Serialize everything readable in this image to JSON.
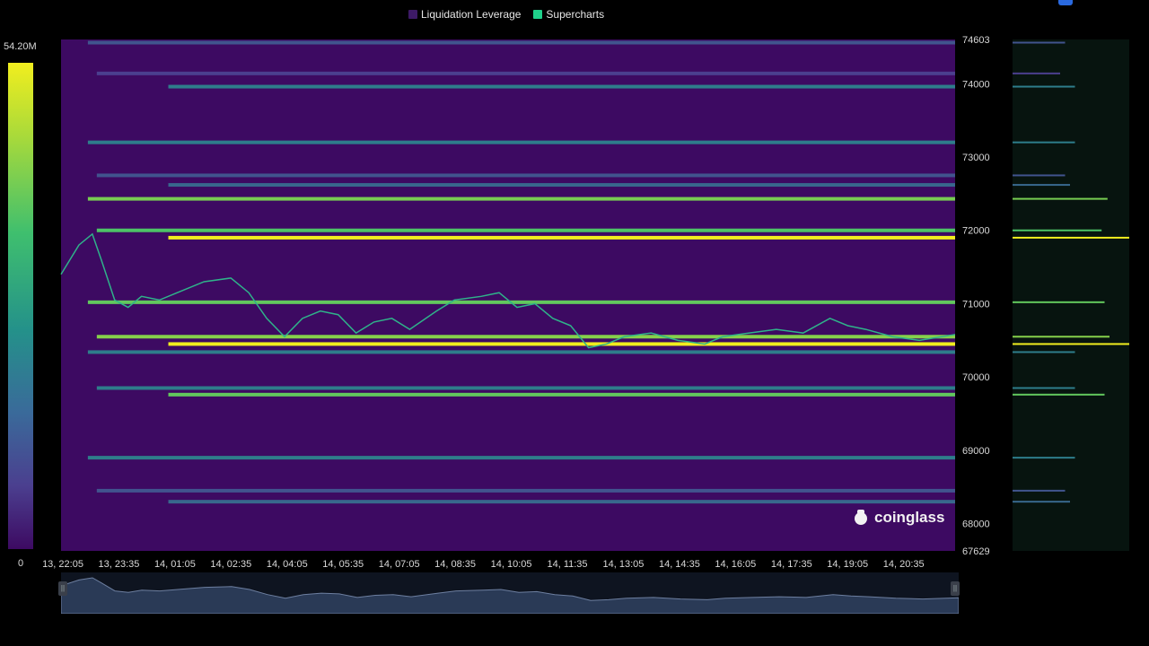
{
  "legend": [
    {
      "label": "Liquidation Leverage",
      "color": "#3d1a66"
    },
    {
      "label": "Supercharts",
      "color": "#1fd18b"
    }
  ],
  "color_scale": {
    "max_label": "54.20M",
    "min_label": "0"
  },
  "watermark": "coinglass",
  "chart_data": {
    "type": "heatmap",
    "title": "",
    "series_names": [
      "Liquidation Leverage",
      "Supercharts"
    ],
    "ylim": [
      67629,
      74603
    ],
    "y_ticks": [
      74603,
      74000,
      73000,
      72000,
      71000,
      70000,
      69000,
      68000,
      67629
    ],
    "x_ticks": [
      "13, 22:05",
      "13, 23:35",
      "14, 01:05",
      "14, 02:35",
      "14, 04:05",
      "14, 05:35",
      "14, 07:05",
      "14, 08:35",
      "14, 10:05",
      "14, 11:35",
      "14, 13:05",
      "14, 14:35",
      "14, 16:05",
      "14, 17:35",
      "14, 19:05",
      "14, 20:35"
    ],
    "color_range": [
      0,
      54.2
    ],
    "color_unit": "M",
    "liquidation_bands": [
      {
        "price": 74560,
        "start": 0.03,
        "intensity": 0.35
      },
      {
        "price": 74140,
        "start": 0.04,
        "intensity": 0.3
      },
      {
        "price": 73960,
        "start": 0.12,
        "intensity": 0.45
      },
      {
        "price": 73200,
        "start": 0.03,
        "intensity": 0.45
      },
      {
        "price": 72750,
        "start": 0.04,
        "intensity": 0.35
      },
      {
        "price": 72620,
        "start": 0.12,
        "intensity": 0.4
      },
      {
        "price": 72430,
        "start": 0.03,
        "intensity": 0.78
      },
      {
        "price": 72000,
        "start": 0.04,
        "intensity": 0.72
      },
      {
        "price": 71900,
        "start": 0.12,
        "intensity": 1.0
      },
      {
        "price": 71020,
        "start": 0.03,
        "intensity": 0.75
      },
      {
        "price": 70550,
        "start": 0.04,
        "intensity": 0.8
      },
      {
        "price": 70450,
        "start": 0.12,
        "intensity": 1.0
      },
      {
        "price": 70340,
        "start": 0.03,
        "intensity": 0.45
      },
      {
        "price": 69850,
        "start": 0.04,
        "intensity": 0.45
      },
      {
        "price": 69760,
        "start": 0.12,
        "intensity": 0.75
      },
      {
        "price": 68900,
        "start": 0.03,
        "intensity": 0.45
      },
      {
        "price": 68450,
        "start": 0.04,
        "intensity": 0.35
      },
      {
        "price": 68300,
        "start": 0.12,
        "intensity": 0.4
      }
    ],
    "price_line": [
      [
        0.0,
        71400
      ],
      [
        0.02,
        71800
      ],
      [
        0.035,
        71950
      ],
      [
        0.045,
        71600
      ],
      [
        0.06,
        71050
      ],
      [
        0.075,
        70950
      ],
      [
        0.09,
        71100
      ],
      [
        0.11,
        71050
      ],
      [
        0.13,
        71150
      ],
      [
        0.16,
        71300
      ],
      [
        0.19,
        71350
      ],
      [
        0.21,
        71150
      ],
      [
        0.23,
        70800
      ],
      [
        0.25,
        70550
      ],
      [
        0.27,
        70800
      ],
      [
        0.29,
        70900
      ],
      [
        0.31,
        70850
      ],
      [
        0.33,
        70600
      ],
      [
        0.35,
        70750
      ],
      [
        0.37,
        70800
      ],
      [
        0.39,
        70650
      ],
      [
        0.42,
        70900
      ],
      [
        0.44,
        71050
      ],
      [
        0.47,
        71100
      ],
      [
        0.49,
        71150
      ],
      [
        0.51,
        70950
      ],
      [
        0.53,
        71000
      ],
      [
        0.55,
        70800
      ],
      [
        0.57,
        70700
      ],
      [
        0.59,
        70400
      ],
      [
        0.61,
        70450
      ],
      [
        0.63,
        70550
      ],
      [
        0.66,
        70600
      ],
      [
        0.69,
        70500
      ],
      [
        0.72,
        70450
      ],
      [
        0.74,
        70550
      ],
      [
        0.77,
        70600
      ],
      [
        0.8,
        70650
      ],
      [
        0.83,
        70600
      ],
      [
        0.86,
        70800
      ],
      [
        0.88,
        70700
      ],
      [
        0.9,
        70650
      ],
      [
        0.93,
        70550
      ],
      [
        0.96,
        70500
      ],
      [
        1.0,
        70580
      ]
    ]
  }
}
